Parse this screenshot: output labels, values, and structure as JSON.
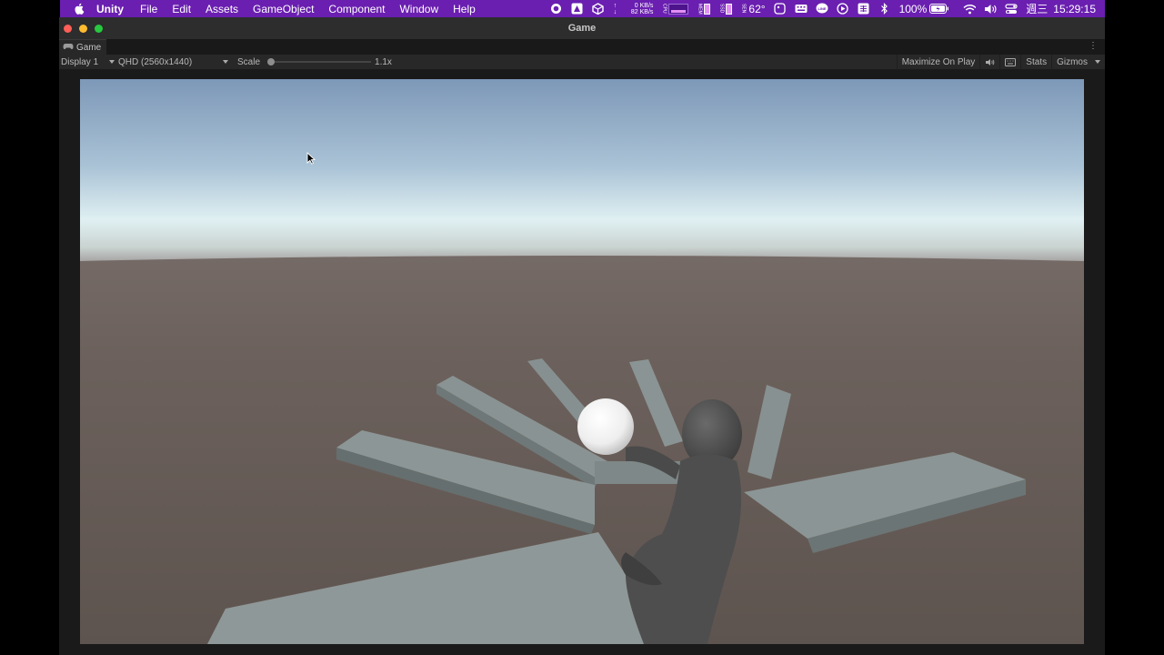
{
  "menubar": {
    "app_name": "Unity",
    "items": [
      "File",
      "Edit",
      "Assets",
      "GameObject",
      "Component",
      "Window",
      "Help"
    ],
    "net_up": "0 KB/s",
    "net_down": "82 KB/s",
    "temperature": "62°",
    "battery": "100%",
    "day": "週三",
    "time": "15:29:15",
    "accent_color": "#6a1fb0"
  },
  "window": {
    "title": "Game",
    "traffic_lights": [
      "#fe5f57",
      "#febc2e",
      "#28c840"
    ]
  },
  "tabs": [
    {
      "label": "Game",
      "icon": "gamepad-icon"
    }
  ],
  "toolbar": {
    "display": "Display 1",
    "resolution": "QHD (2560x1440)",
    "scale_label": "Scale",
    "scale_value": "1.1x",
    "maximize_label": "Maximize On Play",
    "stats_label": "Stats",
    "gizmos_label": "Gizmos"
  }
}
